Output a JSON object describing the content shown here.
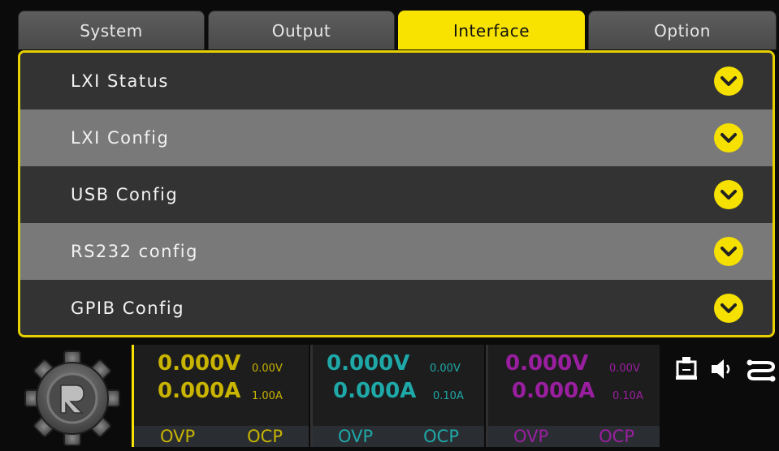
{
  "tabs": [
    {
      "label": "System",
      "active": false
    },
    {
      "label": "Output",
      "active": false
    },
    {
      "label": "Interface",
      "active": true
    },
    {
      "label": "Option",
      "active": false
    }
  ],
  "menu": [
    {
      "label": "LXI Status",
      "icon": "chevron-down-icon"
    },
    {
      "label": "LXI Config",
      "icon": "chevron-down-icon"
    },
    {
      "label": "USB Config",
      "icon": "chevron-down-icon"
    },
    {
      "label": "RS232 config",
      "icon": "chevron-down-icon"
    },
    {
      "label": "GPIB Config",
      "icon": "chevron-down-icon"
    }
  ],
  "channels": [
    {
      "voltage": "0.000V",
      "current": "0.000A",
      "v_set": "0.00V",
      "a_set": "1.00A",
      "ovp": "OVP",
      "ocp": "OCP",
      "color": "#c9b400",
      "line": "#f8e300"
    },
    {
      "voltage": "0.000V",
      "current": "0.000A",
      "v_set": "0.00V",
      "a_set": "0.10A",
      "ovp": "OVP",
      "ocp": "OCP",
      "color": "#1fa8a8",
      "line": "#303030"
    },
    {
      "voltage": "0.000V",
      "current": "0.000A",
      "v_set": "0.00V",
      "a_set": "0.10A",
      "ovp": "OVP",
      "ocp": "OCP",
      "color": "#9a1fa0",
      "line": "#303030"
    }
  ],
  "status_icons": [
    "lan-icon",
    "speaker-icon",
    "link-icon"
  ],
  "colors": {
    "accent": "#f8e300",
    "row_dark": "#333333",
    "row_light": "#797979"
  }
}
